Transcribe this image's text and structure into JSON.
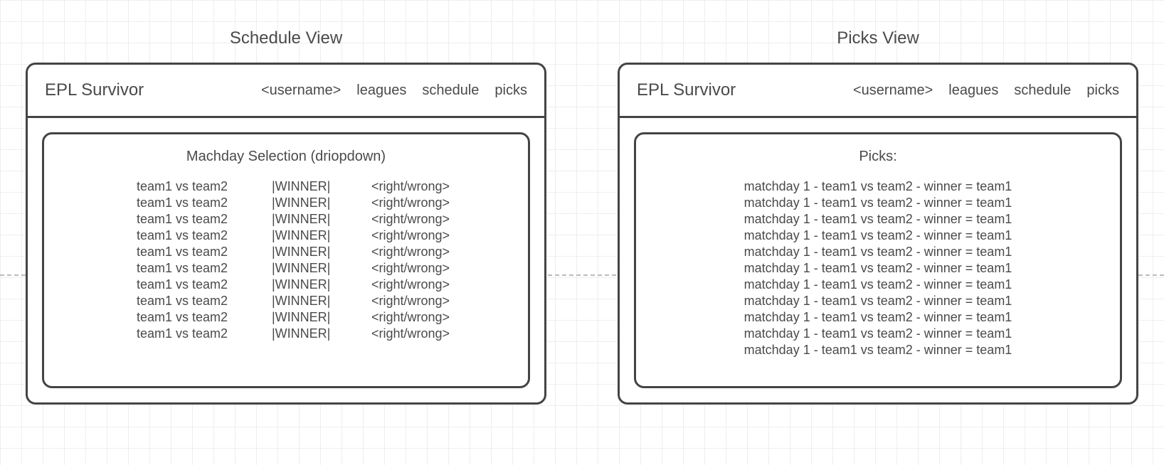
{
  "schedule_view": {
    "label": "Schedule View",
    "header": {
      "title": "EPL Survivor",
      "nav": {
        "username": "<username>",
        "leagues": "leagues",
        "schedule": "schedule",
        "picks": "picks"
      }
    },
    "content": {
      "dropdown_label": "Machday Selection (driopdown)",
      "rows": [
        {
          "match": "team1 vs team2",
          "winner": "|WINNER|",
          "result": "<right/wrong>"
        },
        {
          "match": "team1 vs team2",
          "winner": "|WINNER|",
          "result": "<right/wrong>"
        },
        {
          "match": "team1 vs team2",
          "winner": "|WINNER|",
          "result": "<right/wrong>"
        },
        {
          "match": "team1 vs team2",
          "winner": "|WINNER|",
          "result": "<right/wrong>"
        },
        {
          "match": "team1 vs team2",
          "winner": "|WINNER|",
          "result": "<right/wrong>"
        },
        {
          "match": "team1 vs team2",
          "winner": "|WINNER|",
          "result": "<right/wrong>"
        },
        {
          "match": "team1 vs team2",
          "winner": "|WINNER|",
          "result": "<right/wrong>"
        },
        {
          "match": "team1 vs team2",
          "winner": "|WINNER|",
          "result": "<right/wrong>"
        },
        {
          "match": "team1 vs team2",
          "winner": "|WINNER|",
          "result": "<right/wrong>"
        },
        {
          "match": "team1 vs team2",
          "winner": "|WINNER|",
          "result": "<right/wrong>"
        }
      ]
    }
  },
  "picks_view": {
    "label": "Picks View",
    "header": {
      "title": "EPL Survivor",
      "nav": {
        "username": "<username>",
        "leagues": "leagues",
        "schedule": "schedule",
        "picks": "picks"
      }
    },
    "content": {
      "title": "Picks:",
      "rows": [
        "matchday 1 - team1 vs team2 - winner = team1",
        "matchday 1 - team1 vs team2 - winner = team1",
        "matchday 1 - team1 vs team2 - winner = team1",
        "matchday 1 - team1 vs team2 - winner = team1",
        "matchday 1 - team1 vs team2 - winner = team1",
        "matchday 1 - team1 vs team2 - winner = team1",
        "matchday 1 - team1 vs team2 - winner = team1",
        "matchday 1 - team1 vs team2 - winner = team1",
        "matchday 1 - team1 vs team2 - winner = team1",
        "matchday 1 - team1 vs team2 - winner = team1",
        "matchday 1 - team1 vs team2 - winner = team1"
      ]
    }
  }
}
